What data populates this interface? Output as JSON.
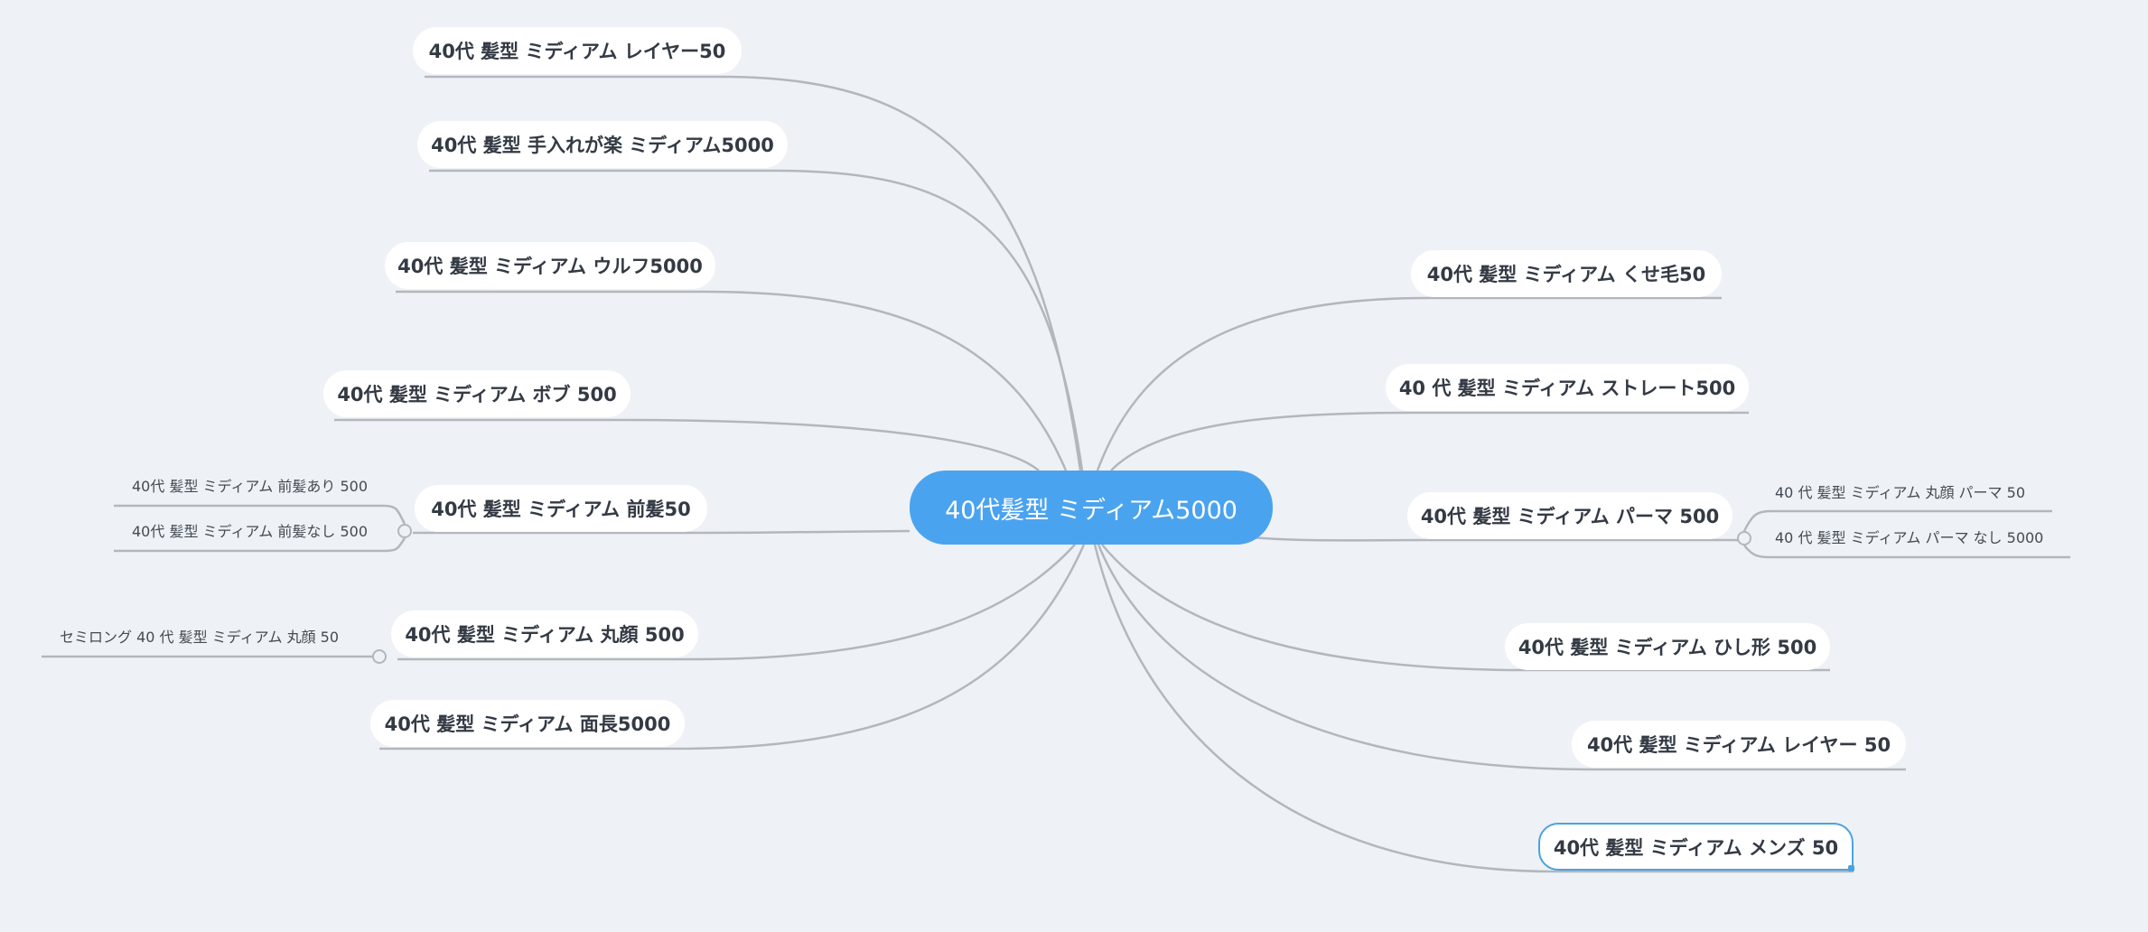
{
  "colors": {
    "background": "#eef2f6",
    "root_fill": "#4aa3ef",
    "node_fill": "#ffffff",
    "line": "#b3b7bd",
    "selection": "#4aa3df"
  },
  "root": {
    "label": "40代髪型 ミディアム5000"
  },
  "left_topics": [
    {
      "id": "l1",
      "label": "40代 髪型 ミディアム レイヤー50",
      "children": []
    },
    {
      "id": "l2",
      "label": "40代 髪型 手入れが楽 ミディアム5000",
      "children": []
    },
    {
      "id": "l3",
      "label": "40代 髪型 ミディアム ウルフ5000",
      "children": []
    },
    {
      "id": "l4",
      "label": "40代 髪型 ミディアム ボブ 500",
      "children": []
    },
    {
      "id": "l5",
      "label": "40代 髪型 ミディアム 前髪50",
      "children": [
        "40代 髪型 ミディアム 前髪あり 500",
        "40代 髪型 ミディアム 前髪なし 500"
      ]
    },
    {
      "id": "l6",
      "label": "40代 髪型 ミディアム 丸顔 500",
      "children": [
        "セミロング 40 代 髪型 ミディアム 丸顔 50"
      ]
    },
    {
      "id": "l7",
      "label": "40代 髪型 ミディアム 面長5000",
      "children": []
    }
  ],
  "right_topics": [
    {
      "id": "r1",
      "label": "40代 髪型 ミディアム くせ毛50",
      "children": []
    },
    {
      "id": "r2",
      "label": "40 代 髪型 ミディアム ストレート500",
      "children": []
    },
    {
      "id": "r3",
      "label": "40代 髪型 ミディアム パーマ 500",
      "children": [
        "40 代 髪型 ミディアム 丸顔 パーマ 50",
        "40 代 髪型 ミディアム パーマ なし 5000"
      ]
    },
    {
      "id": "r4",
      "label": "40代 髪型 ミディアム ひし形 500",
      "children": []
    },
    {
      "id": "r5",
      "label": "40代 髪型 ミディアム レイヤー 50",
      "children": []
    },
    {
      "id": "r6",
      "label": "40代 髪型 ミディアム メンズ 50",
      "children": [],
      "selected": true
    }
  ]
}
